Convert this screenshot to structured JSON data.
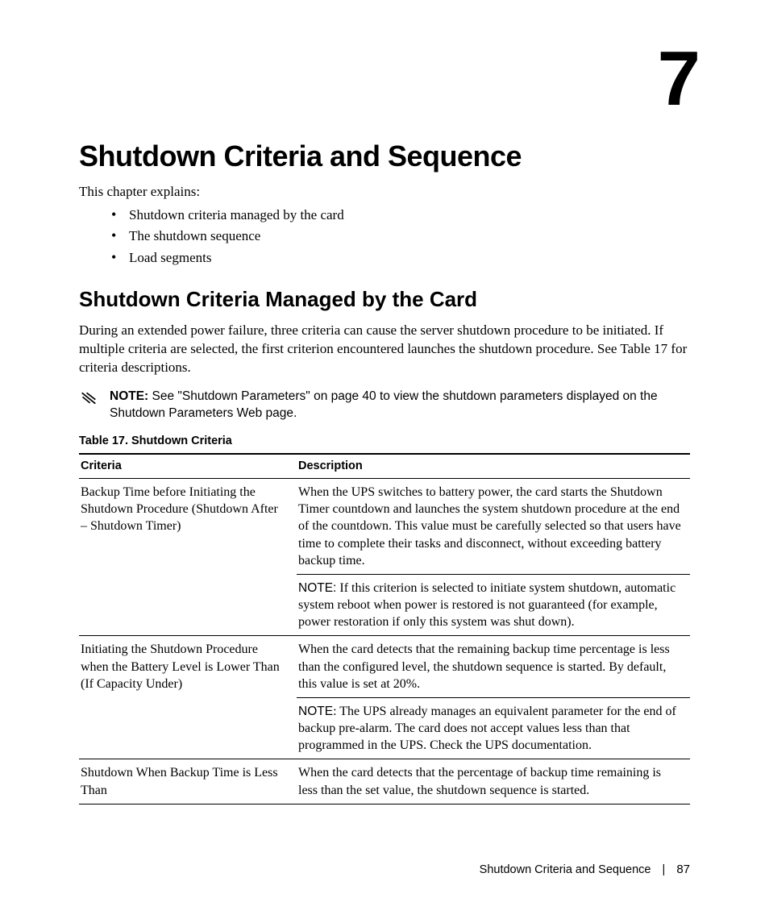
{
  "chapter_number": "7",
  "chapter_title": "Shutdown Criteria and Sequence",
  "intro_line": "This chapter explains:",
  "bullets": [
    "Shutdown criteria managed by the card",
    "The shutdown sequence",
    "Load segments"
  ],
  "section_title": "Shutdown Criteria Managed by the Card",
  "section_body": "During an extended power failure, three criteria can cause the server shutdown procedure to be initiated. If multiple criteria are selected, the first criterion encountered launches the shutdown procedure. See Table 17 for criteria descriptions.",
  "note": {
    "label": "NOTE:",
    "text": " See \"Shutdown Parameters\" on page 40 to view the shutdown parameters displayed on the Shutdown Parameters Web page."
  },
  "table": {
    "caption": "Table 17. Shutdown Criteria",
    "headers": {
      "criteria": "Criteria",
      "description": "Description"
    },
    "rows": [
      {
        "criteria": "Backup Time before Initiating the Shutdown Procedure (Shutdown After – Shutdown Timer)",
        "description": "When the UPS switches to battery power, the card starts the Shutdown Timer countdown and launches the system shutdown procedure at the end of the countdown. This value must be carefully selected so that users have time to complete their tasks and disconnect, without exceeding battery backup time.",
        "subnote_label": "NOTE:",
        "subnote": " If this criterion is selected to initiate system shutdown, automatic system reboot when power is restored is not guaranteed (for example, power restoration if only this system was shut down)."
      },
      {
        "criteria": "Initiating the Shutdown Procedure when the Battery Level is Lower Than (If Capacity Under)",
        "description": "When the card detects that the remaining backup time percentage is less than the configured level, the shutdown sequence is started. By default, this value is set at 20%.",
        "subnote_label": "NOTE",
        "subnote": ": The UPS already manages an equivalent parameter for the end of backup pre-alarm. The card does not accept values less than that programmed in the UPS. Check the UPS documentation."
      },
      {
        "criteria": "Shutdown When Backup Time is Less Than",
        "description": "When the card detects that the percentage of backup time remaining is less than the set value, the shutdown sequence is started."
      }
    ]
  },
  "footer": {
    "title": "Shutdown Criteria and Sequence",
    "page": "87"
  }
}
